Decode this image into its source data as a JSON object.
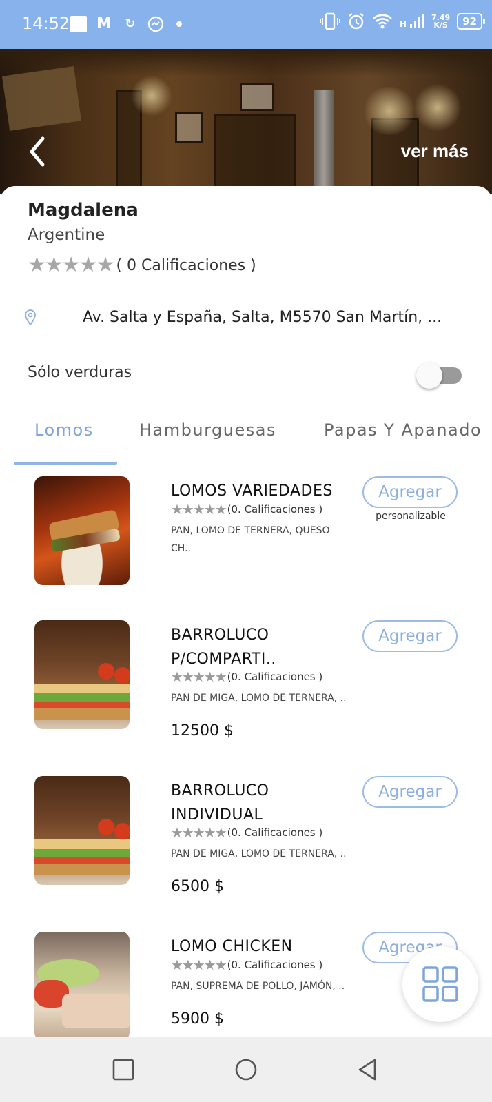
{
  "status_bar": {
    "time": "14:52",
    "speed_value": "7.49",
    "speed_unit": "K/S",
    "network": "H",
    "battery": "92"
  },
  "header": {
    "back_icon": "chevron-left-icon",
    "more_label": "ver más"
  },
  "restaurant": {
    "name": "Magdalena",
    "cuisine": "Argentine",
    "stars": "★★★★★",
    "rating_text": "( 0 Calificaciones )",
    "rating_value": 0,
    "address": "Av. Salta y España, Salta, M5570 San Martín, ...",
    "veg_label": "Sólo verduras",
    "veg_only": false
  },
  "tabs": [
    {
      "label": "Lomos",
      "active": true
    },
    {
      "label": "Hamburguesas",
      "active": false
    },
    {
      "label": "Papas Y Apanado",
      "active": false
    }
  ],
  "items": [
    {
      "title": "LOMOS VARIEDADES",
      "stars": "★★★★★",
      "rating": "(0. Calificaciones )",
      "description": "PAN, LOMO DE TERNERA, QUESO CH..",
      "price": "",
      "button": "Agregar",
      "note": "personalizable"
    },
    {
      "title": "BARROLUCO P/COMPARTI..",
      "stars": "★★★★★",
      "rating": "(0. Calificaciones )",
      "description": "PAN DE MIGA, LOMO DE TERNERA, ..",
      "price": "12500 $",
      "button": "Agregar"
    },
    {
      "title": "BARROLUCO INDIVIDUAL",
      "stars": "★★★★★",
      "rating": "(0. Calificaciones )",
      "description": "PAN DE MIGA, LOMO DE TERNERA, ..",
      "price": "6500 $",
      "button": "Agregar"
    },
    {
      "title": "LOMO CHICKEN",
      "stars": "★★★★★",
      "rating": "(0. Calificaciones )",
      "description": "PAN, SUPREMA DE POLLO, JAMÓN, ..",
      "price": "5900 $",
      "button": "Agregar"
    }
  ],
  "fab_icon": "grid-icon",
  "colors": {
    "status_bar": "#88b2ec",
    "accent": "#8cb0e3",
    "star": "#a7a7a7"
  }
}
